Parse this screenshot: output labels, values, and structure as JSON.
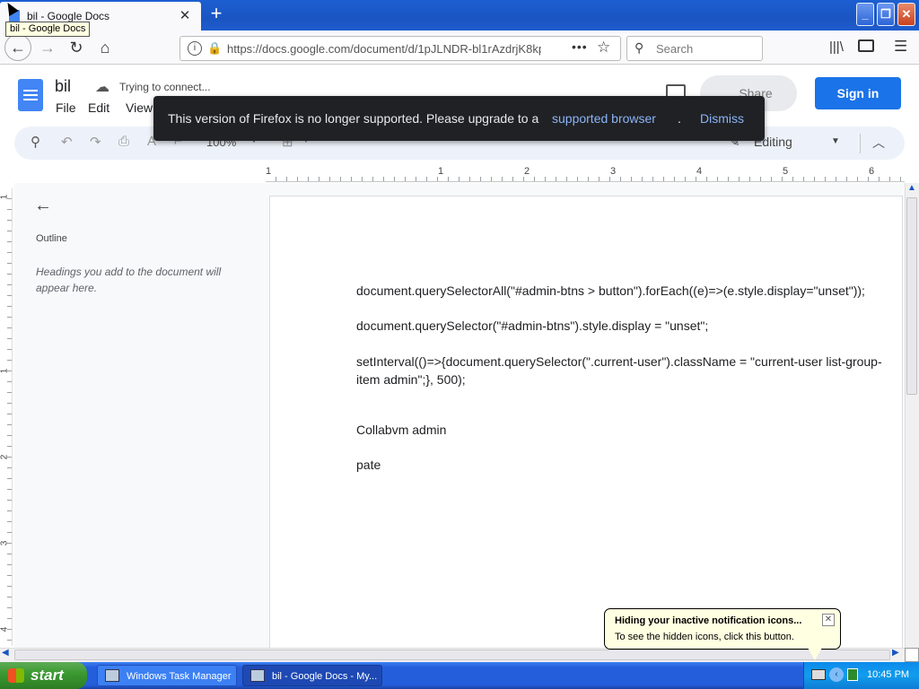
{
  "browser": {
    "tab_title": "bil - Google Docs",
    "tooltip": "bil - Google Docs",
    "new_tab": "+",
    "url": "https://docs.google.com/document/d/1pJLNDR-bl1rAzdrjK8kp",
    "search_placeholder": "Search",
    "page_actions": "•••"
  },
  "docs": {
    "doc_name": "bil",
    "status": "Trying to connect...",
    "menu": [
      "File",
      "Edit",
      "View"
    ],
    "share_label": "Share",
    "signin_label": "Sign in",
    "toolbar": {
      "zoom": "100%",
      "mode": "Editing"
    }
  },
  "toast": {
    "message": "This version of Firefox is no longer supported. Please upgrade to a",
    "link": "supported browser",
    "period": ".",
    "dismiss": "Dismiss"
  },
  "ruler": {
    "numbers": [
      "1",
      "1",
      "2",
      "3",
      "4",
      "5",
      "6"
    ],
    "vertical_numbers": [
      "1",
      "1",
      "2",
      "3",
      "4"
    ]
  },
  "outline": {
    "title": "Outline",
    "hint": "Headings you add to the document will appear here."
  },
  "document": {
    "lines": [
      "document.querySelectorAll(\"#admin-btns > button\").forEach((e)=>(e.style.display=\"unset\"));",
      "document.querySelector(\"#admin-btns\").style.display = \"unset\";",
      "setInterval(()=>{document.querySelector(\".current-user\").className = \"current-user list-group-item admin\";}, 500);",
      "Collabvm admin",
      "pate"
    ]
  },
  "balloon": {
    "title": "Hiding your inactive notification icons...",
    "body": "To see the hidden icons, click this button."
  },
  "taskbar": {
    "start": "start",
    "tasks": [
      "Windows Task Manager",
      "bil - Google Docs - My..."
    ],
    "clock": "10:45 PM"
  },
  "colors": {
    "docs_blue": "#1a73e8",
    "toast_bg": "#202124",
    "toast_link": "#8ab4f8",
    "xp_taskbar": "#245edb",
    "xp_start": "#3c9a32"
  },
  "icons": [
    "favicon-docs-icon",
    "close-icon",
    "back-arrow-icon",
    "forward-arrow-icon",
    "reload-icon",
    "home-icon",
    "info-icon",
    "lock-icon",
    "bookmark-star-icon",
    "search-icon",
    "library-icon",
    "sidebar-icon",
    "hamburger-menu-icon",
    "cloud-offline-icon",
    "comment-icon",
    "undo-icon",
    "redo-icon",
    "print-icon",
    "spellcheck-icon",
    "paint-format-icon",
    "pencil-icon",
    "chevron-up-icon",
    "windows-flag-icon"
  ]
}
